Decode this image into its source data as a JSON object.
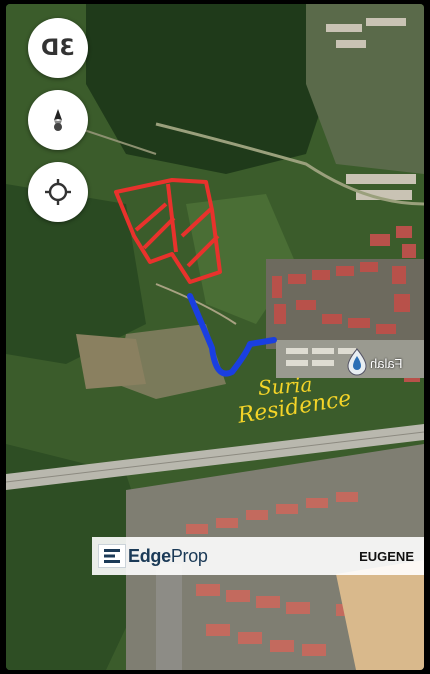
{
  "map": {
    "controls": {
      "btn_3d_label": "3D",
      "compass_icon": "compass-needle-icon",
      "locate_icon": "my-location-crosshair-icon"
    },
    "place_label": "Falah",
    "place_pin_icon": "water-drop-pin-icon",
    "annotation_colors": {
      "plot_outline": "#e8322c",
      "access_path": "#1a3fe0",
      "handwriting": "#f4d428"
    },
    "handwritten_note": {
      "line1": "Suria",
      "line2": "Residence"
    }
  },
  "watermark": {
    "logo_part1": "Edge",
    "logo_part2": "Prop",
    "agent_name": "EUGENE"
  }
}
